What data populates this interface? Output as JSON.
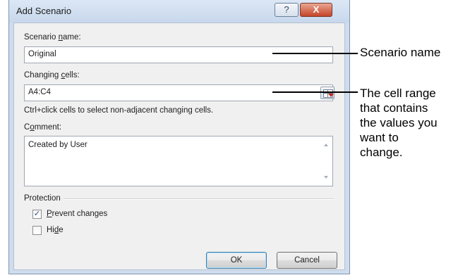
{
  "dialog": {
    "title": "Add Scenario",
    "help_button": "?",
    "close_button": "X",
    "scenario_name": {
      "label_pre": "Scenario ",
      "label_u": "n",
      "label_post": "ame:",
      "value": "Original"
    },
    "changing_cells": {
      "label_pre": "Changing ",
      "label_u": "c",
      "label_post": "ells:",
      "value": "A4:C4",
      "hint": "Ctrl+click cells to select non-adjacent changing cells."
    },
    "comment": {
      "label_pre": "C",
      "label_u": "o",
      "label_post": "mment:",
      "value": "Created by User"
    },
    "protection": {
      "label": "Protection",
      "prevent_changes": {
        "label_u": "P",
        "label_post": "revent changes",
        "checked": true,
        "check_glyph": "✓"
      },
      "hide": {
        "label_pre": "Hi",
        "label_u": "d",
        "label_post": "e",
        "checked": false
      }
    },
    "ok_label": "OK",
    "cancel_label": "Cancel"
  },
  "callouts": {
    "scenario_name": "Scenario name",
    "cell_range": [
      "The cell range",
      "that contains",
      "the values you",
      "want to",
      "change."
    ]
  },
  "colors": {
    "frame": "#cfdced",
    "close": "#c4442a",
    "check": "#2a4f8f"
  }
}
